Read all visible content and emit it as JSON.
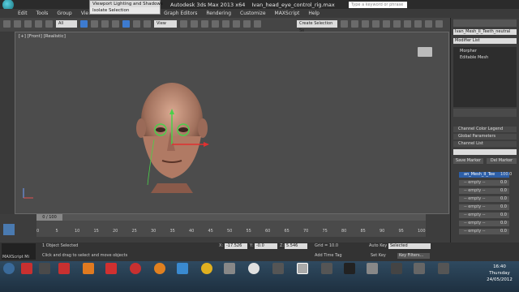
{
  "window": {
    "app_title": "Autodesk 3ds Max  2013 x64",
    "file_title": "Ivan_head_eye_control_rig.max",
    "search_placeholder": "Type a keyword or phrase"
  },
  "menu": [
    "Edit",
    "Tools",
    "Group",
    "Vie",
    "ion",
    "Graph Editors",
    "Rendering",
    "Customize",
    "MAXScript",
    "Help"
  ],
  "dropdown": [
    "Viewport Lighting and Shadows",
    "Isolate Selection"
  ],
  "toolbar": {
    "selection_filter": "All",
    "ref_coord": "View",
    "named_sel": "Create Selection Se"
  },
  "viewport": {
    "label": "[+] [Front] [Realistic]"
  },
  "command_panel": {
    "object_name": "Ivan_Mesh_II_Teeth_neutral",
    "modifier_list": "Modifier List",
    "stack": [
      "Morpher",
      "Editable Mesh"
    ],
    "rollouts": [
      "Channel Color Legend",
      "Global Parameters",
      "Channel List"
    ],
    "save_marker": "Save Marker",
    "del_marker": "Del Marker",
    "channel_first": "an_Mesh_II_Tee",
    "channel_empty": "-- empty --",
    "channel_value": "0.0",
    "channel_value_first": "100.0"
  },
  "timeline": {
    "frame": "0 / 100",
    "ticks": [
      "0",
      "5",
      "10",
      "15",
      "20",
      "25",
      "30",
      "35",
      "40",
      "45",
      "50",
      "55",
      "60",
      "65",
      "70",
      "75",
      "80",
      "85",
      "90",
      "95",
      "100"
    ]
  },
  "status": {
    "selected": "1 Object Selected",
    "prompt": "Click and drag to select and move objects",
    "x_label": "X:",
    "x": "-17.526",
    "y_label": "Y:",
    "y": "-0.0",
    "z_label": "Z:",
    "z": "5.546",
    "grid": "Grid = 10.0",
    "add_time_tag": "Add Time Tag",
    "auto_key": "Auto Key",
    "set_key": "Set Key",
    "key_mode": "Selected",
    "key_filters": "Key Filters...",
    "maxscript": "MAXScript Mi"
  },
  "clock": {
    "time": "16:40",
    "day": "Thursday",
    "date": "24/05/2012"
  },
  "colors": {
    "accent": "#3d7bd0",
    "gizmo_green": "#4ad04a",
    "gizmo_red": "#e03030"
  }
}
